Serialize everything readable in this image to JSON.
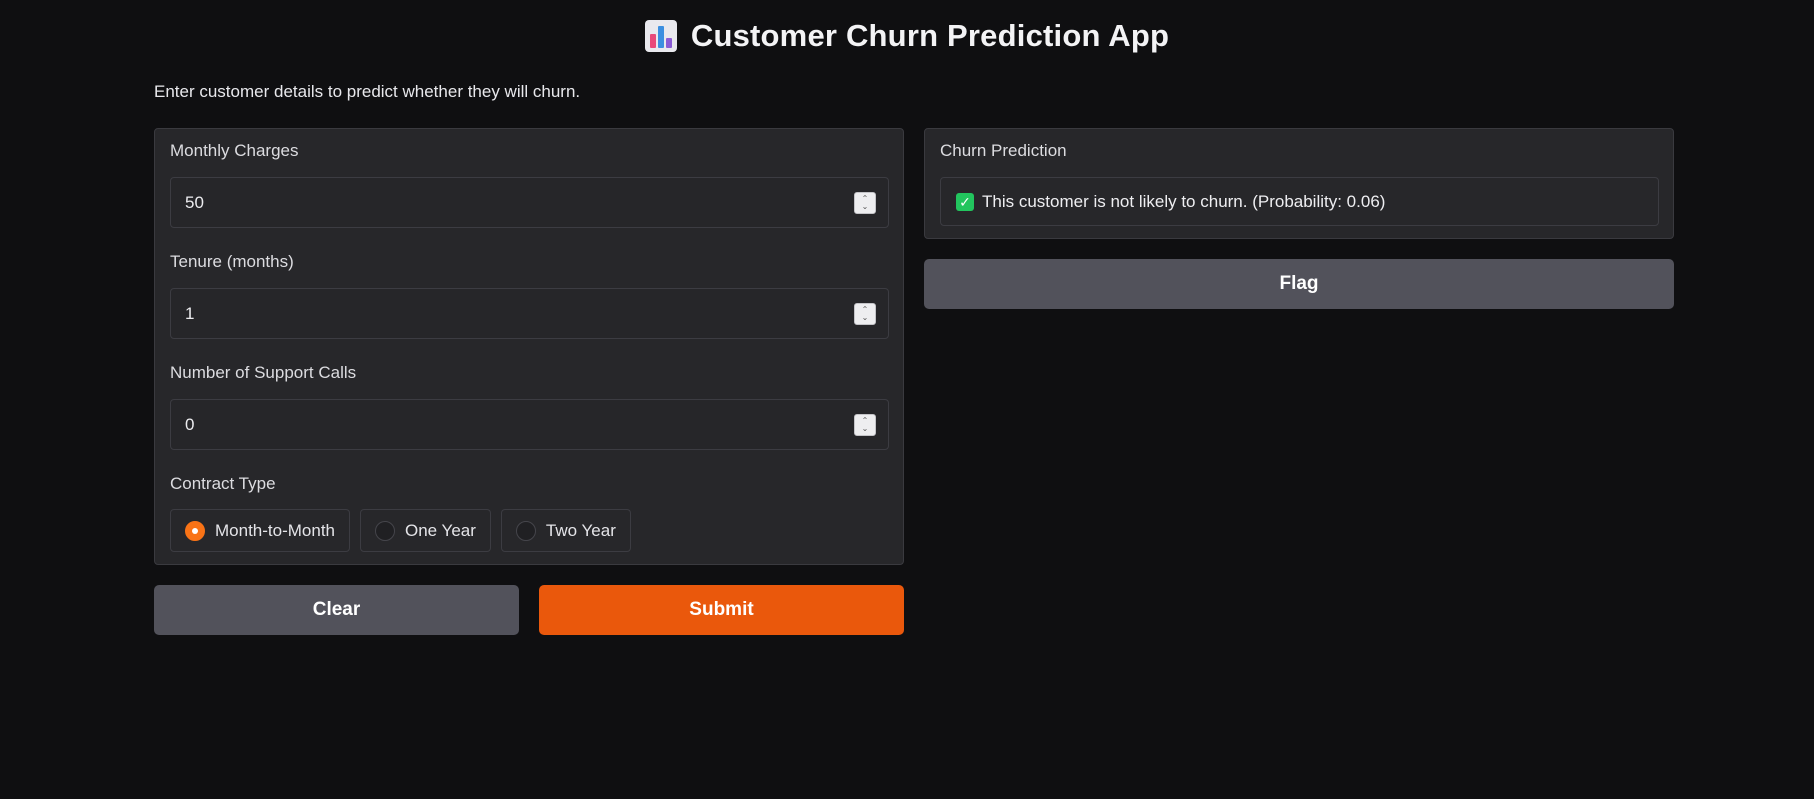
{
  "header": {
    "title": "Customer Churn Prediction App",
    "icon": "bar-chart-icon",
    "subtitle": "Enter customer details to predict whether they will churn."
  },
  "inputs": {
    "monthly_charges": {
      "label": "Monthly Charges",
      "value": "50"
    },
    "tenure": {
      "label": "Tenure (months)",
      "value": "1"
    },
    "support_calls": {
      "label": "Number of Support Calls",
      "value": "0"
    },
    "contract_type": {
      "label": "Contract Type",
      "options": [
        "Month-to-Month",
        "One Year",
        "Two Year"
      ],
      "selected": "Month-to-Month"
    }
  },
  "buttons": {
    "clear": "Clear",
    "submit": "Submit",
    "flag": "Flag"
  },
  "output": {
    "label": "Churn Prediction",
    "text": "This customer is not likely to churn. (Probability: 0.06)"
  },
  "colors": {
    "accent": "#ea580c",
    "secondary_button": "#52525b",
    "panel": "#27272a",
    "background": "#0f0f11",
    "success": "#22c55e"
  }
}
